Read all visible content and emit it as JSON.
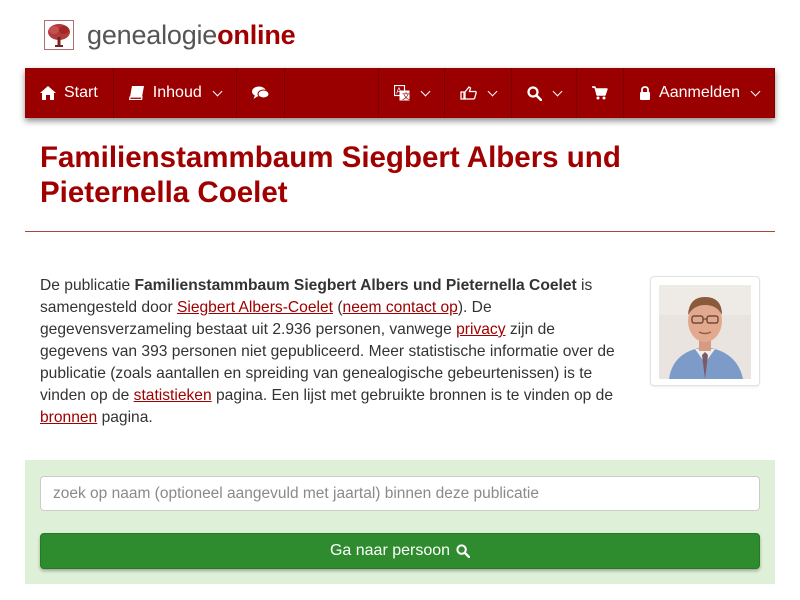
{
  "brand": {
    "part1": "genealogie",
    "part2": "online",
    "icon": "tree-logo-icon"
  },
  "nav": {
    "start": {
      "label": "Start",
      "icon": "home-icon"
    },
    "inhoud": {
      "label": "Inhoud",
      "icon": "book-icon"
    },
    "comments": {
      "icon": "comments-icon"
    },
    "language": {
      "icon": "translate-icon"
    },
    "share": {
      "icon": "thumbs-up-icon"
    },
    "search": {
      "icon": "search-icon"
    },
    "cart": {
      "icon": "cart-icon"
    },
    "login": {
      "label": "Aanmelden",
      "icon": "lock-icon"
    }
  },
  "page": {
    "title": "Familienstammbaum Siegbert Albers und Pieternella Coelet"
  },
  "intro": {
    "t1": "De publicatie ",
    "pub_name": "Familienstammbaum Siegbert Albers und Pieternella Coelet",
    "t2": " is samengesteld door ",
    "author_link": "Siegbert Albers-Coelet",
    "t3": " (",
    "contact_link": "neem contact op",
    "t4": "). De gegevensverzameling bestaat uit 2.936 personen, vanwege ",
    "privacy_link": "privacy",
    "t5": " zijn de gegevens van 393 personen niet gepubliceerd. Meer statistische informatie over de publicatie (zoals aantallen en spreiding van genealogische gebeurtenissen) is te vinden op de ",
    "stats_link": "statistieken",
    "t6": " pagina. Een lijst met gebruikte bronnen is te vinden op de ",
    "sources_link": "bronnen",
    "t7": " pagina."
  },
  "search": {
    "placeholder": "zoek op naam (optioneel aangevuld met jaartal) binnen deze publicatie",
    "value": "",
    "button_label": "Ga naar persoon"
  },
  "colors": {
    "brand_red": "#9a0000",
    "title_red": "#a00000",
    "panel_green": "#dff0d8",
    "button_green": "#2e8b2e"
  }
}
